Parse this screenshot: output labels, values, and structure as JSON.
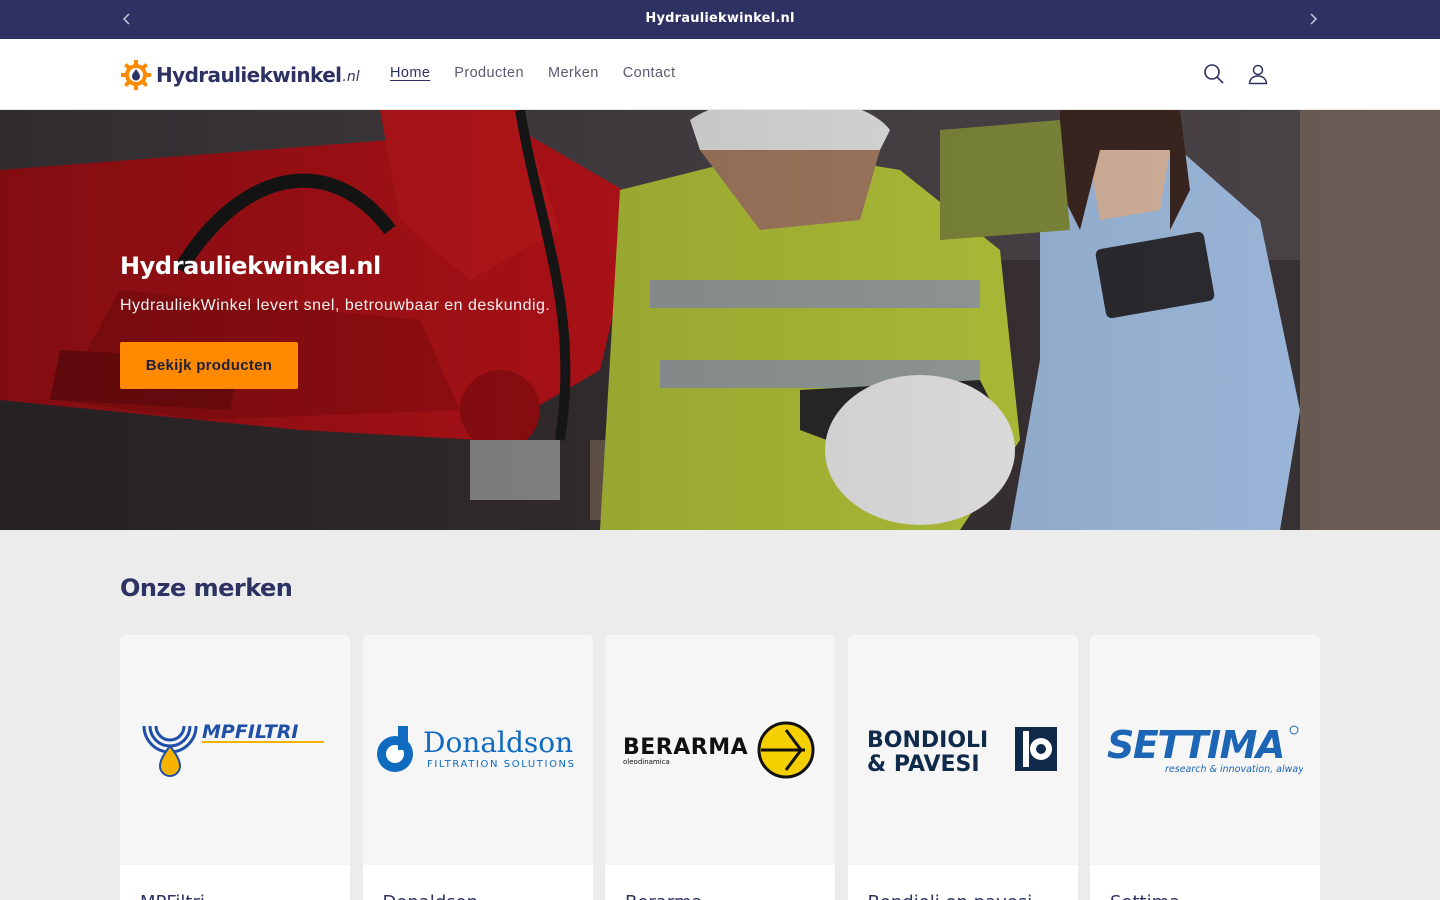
{
  "announcement": {
    "text": "Hydrauliekwinkel.nl"
  },
  "header": {
    "logo_word": "Hydrauliekwinkel",
    "logo_tld": ".nl",
    "nav": [
      "Home",
      "Producten",
      "Merken",
      "Contact"
    ],
    "active_nav": "Home",
    "icons": [
      "search-icon",
      "account-icon"
    ]
  },
  "hero": {
    "title": "Hydrauliekwinkel.nl",
    "subtitle": "HydrauliekWinkel levert snel, betrouwbaar en deskundig.",
    "button_label": "Bekijk producten"
  },
  "brands": {
    "title": "Onze merken",
    "items": [
      {
        "name": "MPFiltri",
        "logo_text": "MPFILTRI"
      },
      {
        "name": "Donaldson",
        "logo_text": "Donaldson",
        "logo_sub": "FILTRATION SOLUTIONS"
      },
      {
        "name": "Berarma",
        "logo_text": "BERARMA",
        "logo_sub": "oleodinamica"
      },
      {
        "name": "Bondioli en pavesi",
        "logo_text": "BONDIOLI",
        "logo_text2": "& PAVESI"
      },
      {
        "name": "Settima",
        "logo_text": "SETTIMA",
        "logo_sub": "research & innovation, always"
      }
    ]
  },
  "colors": {
    "navy": "#2e3262",
    "orange": "#ff8a00",
    "page_bg": "#ececec"
  }
}
